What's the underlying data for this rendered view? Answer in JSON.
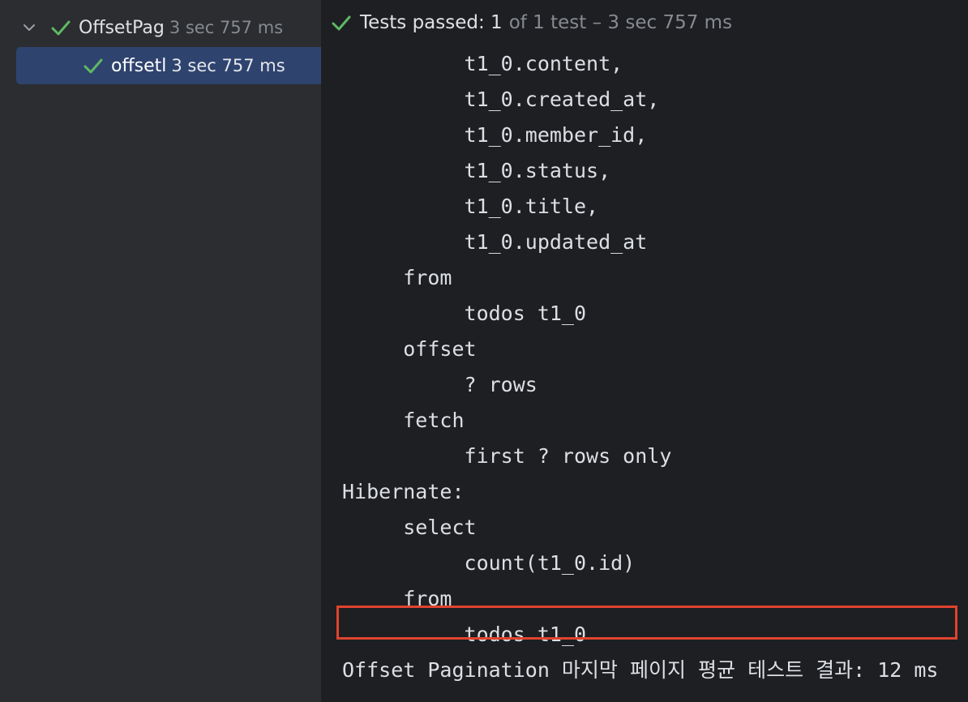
{
  "tree": {
    "root": {
      "name": "OffsetPag",
      "time": "3 sec 757 ms",
      "icons": [
        "chevron-down-icon",
        "check-icon"
      ]
    },
    "child": {
      "name": "offsetl",
      "time": "3 sec 757 ms",
      "icons": [
        "check-icon"
      ]
    }
  },
  "status": {
    "main": "Tests passed: 1",
    "sub": "of 1 test – 3 sec 757 ms",
    "icon": "check-icon"
  },
  "console": {
    "lines": [
      "          t1_0.content,",
      "          t1_0.created_at,",
      "          t1_0.member_id,",
      "          t1_0.status,",
      "          t1_0.title,",
      "          t1_0.updated_at",
      "     from",
      "          todos t1_0",
      "     offset",
      "          ? rows",
      "     fetch",
      "          first ? rows only",
      "Hibernate:",
      "     select",
      "          count(t1_0.id)",
      "     from",
      "          todos t1_0",
      "Offset Pagination 마지막 페이지 평균 테스트 결과: 12 ms"
    ]
  },
  "colors": {
    "success_green": "#5fb865",
    "selection": "#2e436e",
    "highlight_border": "#e0432e",
    "panel_bg": "#2b2d30",
    "console_bg": "#1e1f22"
  }
}
